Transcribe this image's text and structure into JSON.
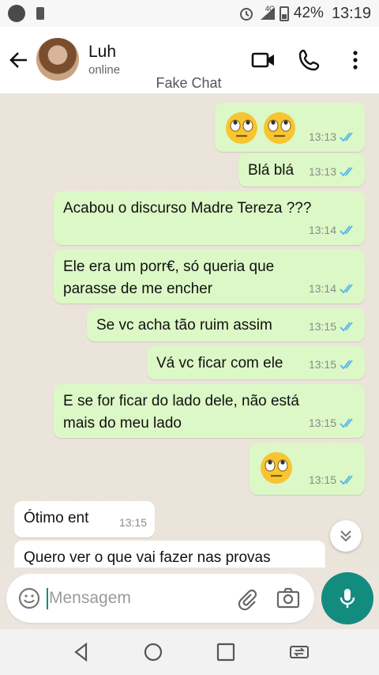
{
  "status_bar": {
    "signal_label": "4G",
    "battery": "42%",
    "time": "13:19"
  },
  "header": {
    "contact_name": "Luh",
    "contact_status": "online",
    "watermark": "Fake Chat"
  },
  "messages": [
    {
      "direction": "out",
      "type": "emoji",
      "emoji": "face-with-rolling-eyes",
      "count": 2,
      "time": "13:13",
      "status": "read"
    },
    {
      "direction": "out",
      "type": "text",
      "text": "Blá blá",
      "time": "13:13",
      "status": "read"
    },
    {
      "direction": "out",
      "type": "text",
      "text": "Acabou o discurso Madre Tereza ???",
      "time": "13:14",
      "status": "read"
    },
    {
      "direction": "out",
      "type": "text",
      "text": "Ele era um porr€, só queria que\nparasse de me encher",
      "time": "13:14",
      "status": "read"
    },
    {
      "direction": "out",
      "type": "text",
      "text": "Se vc acha tão ruim assim",
      "time": "13:15",
      "status": "read"
    },
    {
      "direction": "out",
      "type": "text",
      "text": "Vá vc ficar com ele",
      "time": "13:15",
      "status": "read"
    },
    {
      "direction": "out",
      "type": "text",
      "text": "E se for ficar do lado dele, não está\nmais do meu lado",
      "time": "13:15",
      "status": "read"
    },
    {
      "direction": "out",
      "type": "emoji",
      "emoji": "face-with-rolling-eyes",
      "count": 1,
      "time": "13:15",
      "status": "read"
    },
    {
      "direction": "in",
      "type": "text",
      "text": "Ótimo ent",
      "time": "13:15"
    },
    {
      "direction": "in",
      "type": "text",
      "text": "Quero ver o que vai fazer nas provas",
      "time": ""
    }
  ],
  "composer": {
    "placeholder": "Mensagem",
    "value": ""
  },
  "icons": {
    "back": "arrow-left-icon",
    "video": "video-call-icon",
    "call": "phone-icon",
    "menu": "more-vert-icon",
    "emoji": "emoji-icon",
    "attach": "paperclip-icon",
    "camera": "camera-icon",
    "mic": "mic-icon",
    "scroll": "chevron-double-down-icon"
  },
  "colors": {
    "outgoing": "#dcf8c6",
    "incoming": "#ffffff",
    "accent": "#128c7e",
    "read_ticks": "#4fb6ec"
  }
}
